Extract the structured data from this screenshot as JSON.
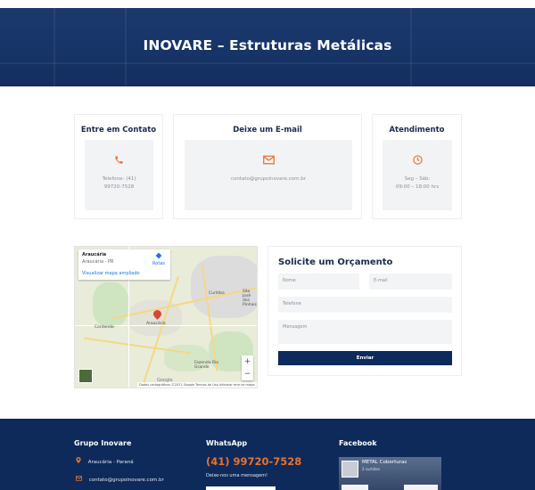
{
  "hero": {
    "title": "INOVARE – Estruturas Metálicas"
  },
  "contact_cards": [
    {
      "title": "Entre em Contato",
      "icon": "phone-icon",
      "lines": [
        "Telefone: (41)",
        "99720-7528"
      ]
    },
    {
      "title": "Deixe um E-mail",
      "icon": "envelope-icon",
      "lines": [
        "contato@grupoinovare.com.br"
      ]
    },
    {
      "title": "Atendimento",
      "icon": "clock-icon",
      "lines": [
        "Seg – Sáb:",
        "09:00 – 18:00 hrs"
      ]
    }
  ],
  "map": {
    "city": "Araucária",
    "state": "Araucária - PR",
    "directions": "Rotas",
    "enlarge_link": "Visualizar mapa ampliado",
    "labels": [
      "Araucária",
      "Fazenda Rio Grande",
      "São José dos Pinhais",
      "Curitiba",
      "Contenda"
    ],
    "google": "Google",
    "footer_text": "Dados cartográficos ©2021 Google   Termos de Uso   Informar erro no mapa",
    "zoom_in": "+",
    "zoom_out": "−"
  },
  "quote_form": {
    "title": "Solicite um Orçamento",
    "name_placeholder": "Nome",
    "email_placeholder": "E-mail",
    "phone_placeholder": "Telefone",
    "message_placeholder": "Mensagem",
    "submit_label": "Enviar"
  },
  "footer": {
    "col1_title": "Grupo Inovare",
    "location": "Araucária - Paraná",
    "email": "contato@grupoinovare.com.br",
    "col2_title": "WhatsApp",
    "phone": "(41) 99720-7528",
    "phone_sub": "Deixe-nos uma mensagem!",
    "col3_title": "Facebook",
    "fb_page_name": "METAL Coberturas",
    "fb_likes": "2 curtidas"
  },
  "colors": {
    "navy": "#0d2a5b",
    "accent": "#e8722c",
    "card_bg": "#f2f3f5"
  }
}
